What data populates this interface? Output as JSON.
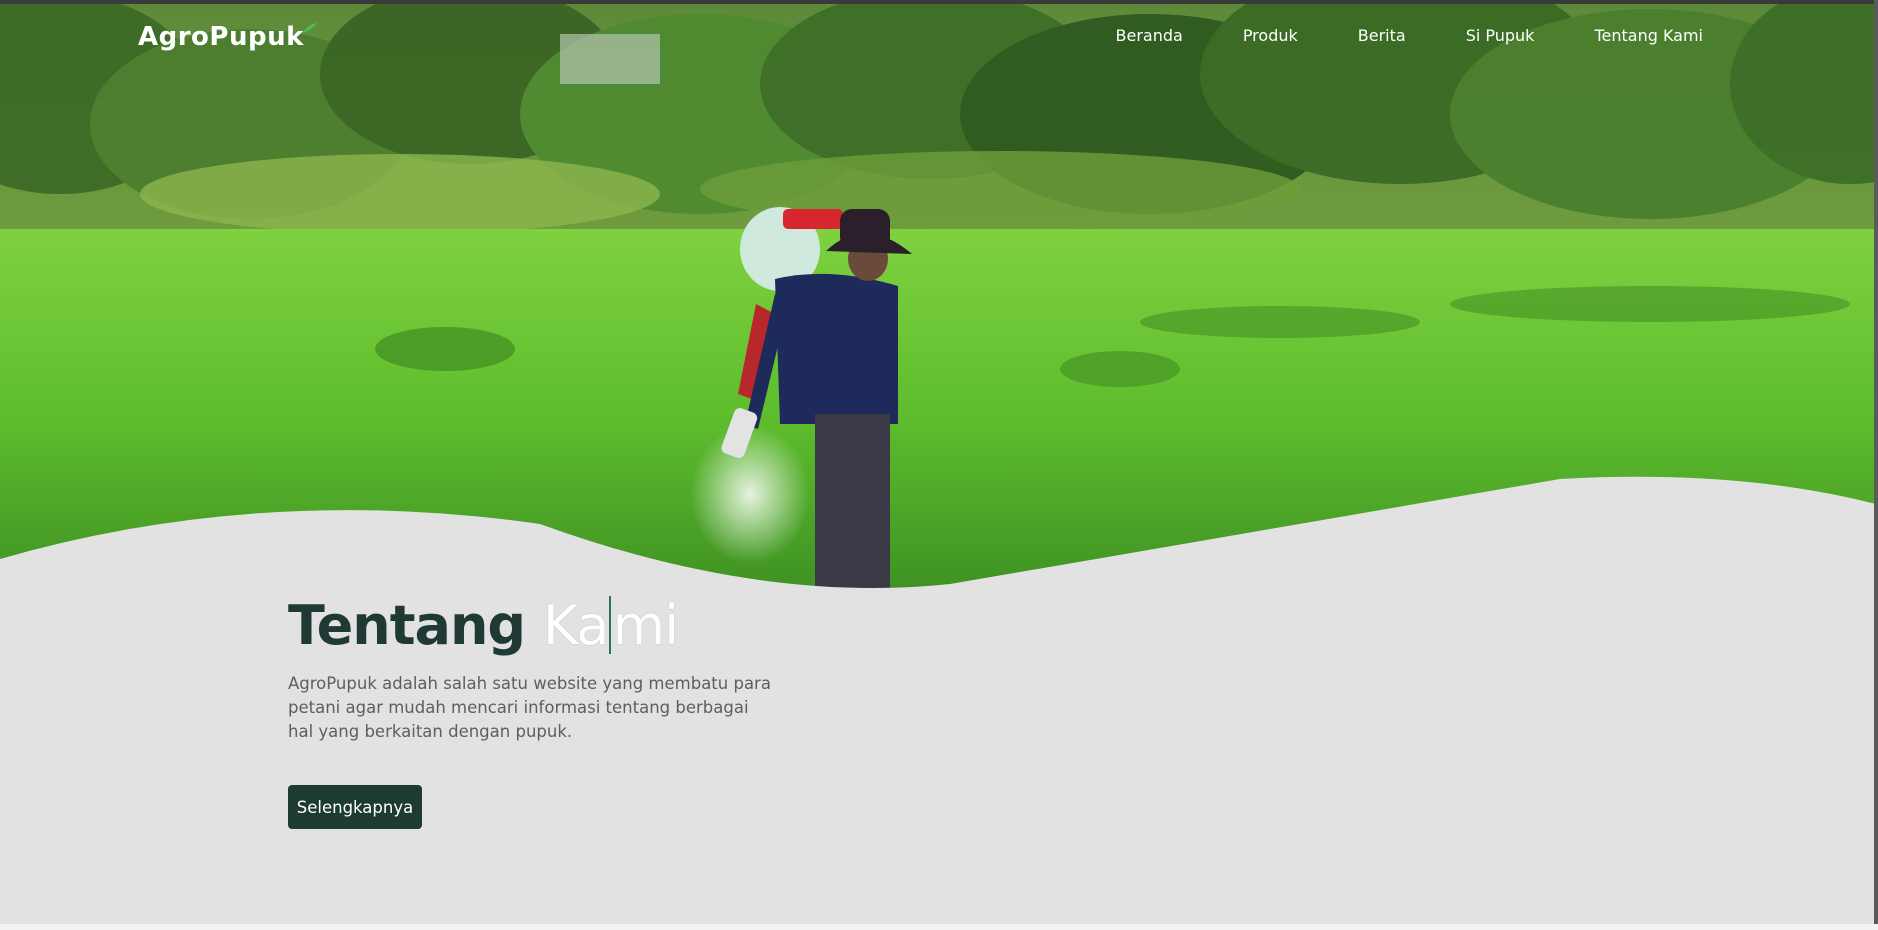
{
  "brand": {
    "name": "AgroPupuk"
  },
  "nav": {
    "items": [
      {
        "label": "Beranda"
      },
      {
        "label": "Produk"
      },
      {
        "label": "Berita"
      },
      {
        "label": "Si Pupuk"
      },
      {
        "label": "Tentang Kami"
      }
    ]
  },
  "hero": {
    "title_part1": "Tentang",
    "title_part2a": "Ka",
    "title_part2b": "mi",
    "description": "AgroPupuk adalah salah satu website yang membatu para petani agar mudah mencari informasi tentang berbagai hal yang berkaitan dengan pupuk.",
    "cta_label": "Selengkapnya"
  },
  "colors": {
    "accent": "#1d3a33",
    "background": "#e2e2e2",
    "field_green": "#6cc13a",
    "forest_green": "#3f7a2e"
  },
  "icons": {
    "logo_mark": "leaf-icon"
  }
}
